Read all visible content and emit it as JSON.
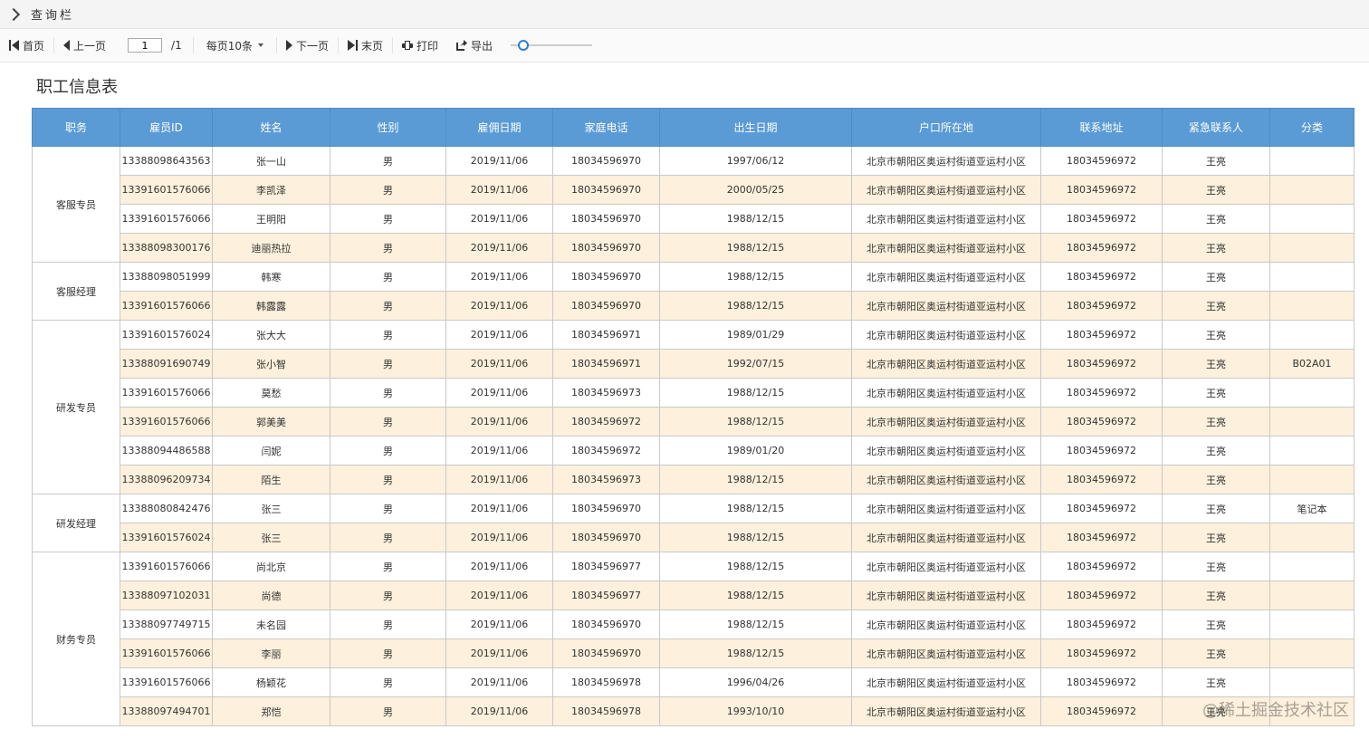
{
  "query_bar": {
    "label": "查询栏"
  },
  "toolbar": {
    "first": "首页",
    "prev": "上一页",
    "page_value": "1",
    "page_total": "/1",
    "page_size": "每页10条",
    "next": "下一页",
    "last": "末页",
    "print": "打印",
    "export": "导出",
    "zoom_fraction": 0.1
  },
  "report": {
    "title": "职工信息表",
    "columns": [
      "职务",
      "雇员ID",
      "姓名",
      "性别",
      "雇佣日期",
      "家庭电话",
      "出生日期",
      "户口所在地",
      "联系地址",
      "紧急联系人",
      "分类"
    ],
    "groups": [
      {
        "position": "客服专员",
        "rows": [
          [
            "13388098643563",
            "张一山",
            "男",
            "2019/11/06",
            "18034596970",
            "1997/06/12",
            "北京市朝阳区奥运村街道亚运村小区",
            "18034596972",
            "王亮",
            ""
          ],
          [
            "13391601576066",
            "李凯泽",
            "男",
            "2019/11/06",
            "18034596970",
            "2000/05/25",
            "北京市朝阳区奥运村街道亚运村小区",
            "18034596972",
            "王亮",
            ""
          ],
          [
            "13391601576066",
            "王明阳",
            "男",
            "2019/11/06",
            "18034596970",
            "1988/12/15",
            "北京市朝阳区奥运村街道亚运村小区",
            "18034596972",
            "王亮",
            ""
          ],
          [
            "13388098300176",
            "迪丽热拉",
            "男",
            "2019/11/06",
            "18034596970",
            "1988/12/15",
            "北京市朝阳区奥运村街道亚运村小区",
            "18034596972",
            "王亮",
            ""
          ]
        ]
      },
      {
        "position": "客服经理",
        "rows": [
          [
            "13388098051999",
            "韩寒",
            "男",
            "2019/11/06",
            "18034596970",
            "1988/12/15",
            "北京市朝阳区奥运村街道亚运村小区",
            "18034596972",
            "王亮",
            ""
          ],
          [
            "13391601576066",
            "韩露露",
            "男",
            "2019/11/06",
            "18034596970",
            "1988/12/15",
            "北京市朝阳区奥运村街道亚运村小区",
            "18034596972",
            "王亮",
            ""
          ]
        ]
      },
      {
        "position": "研发专员",
        "rows": [
          [
            "13391601576024",
            "张大大",
            "男",
            "2019/11/06",
            "18034596971",
            "1989/01/29",
            "北京市朝阳区奥运村街道亚运村小区",
            "18034596972",
            "王亮",
            ""
          ],
          [
            "13388091690749",
            "张小智",
            "男",
            "2019/11/06",
            "18034596971",
            "1992/07/15",
            "北京市朝阳区奥运村街道亚运村小区",
            "18034596972",
            "王亮",
            "B02A01"
          ],
          [
            "13391601576066",
            "莫愁",
            "男",
            "2019/11/06",
            "18034596973",
            "1988/12/15",
            "北京市朝阳区奥运村街道亚运村小区",
            "18034596972",
            "王亮",
            ""
          ],
          [
            "13391601576066",
            "郭美美",
            "男",
            "2019/11/06",
            "18034596972",
            "1988/12/15",
            "北京市朝阳区奥运村街道亚运村小区",
            "18034596972",
            "王亮",
            ""
          ],
          [
            "13388094486588",
            "闫妮",
            "男",
            "2019/11/06",
            "18034596972",
            "1989/01/20",
            "北京市朝阳区奥运村街道亚运村小区",
            "18034596972",
            "王亮",
            ""
          ],
          [
            "13388096209734",
            "陌生",
            "男",
            "2019/11/06",
            "18034596973",
            "1988/12/15",
            "北京市朝阳区奥运村街道亚运村小区",
            "18034596972",
            "王亮",
            ""
          ]
        ]
      },
      {
        "position": "研发经理",
        "rows": [
          [
            "13388080842476",
            "张三",
            "男",
            "2019/11/06",
            "18034596970",
            "1988/12/15",
            "北京市朝阳区奥运村街道亚运村小区",
            "18034596972",
            "王亮",
            "笔记本"
          ],
          [
            "13391601576024",
            "张三",
            "男",
            "2019/11/06",
            "18034596970",
            "1988/12/15",
            "北京市朝阳区奥运村街道亚运村小区",
            "18034596972",
            "王亮",
            ""
          ]
        ]
      },
      {
        "position": "财务专员",
        "rows": [
          [
            "13391601576066",
            "尚北京",
            "男",
            "2019/11/06",
            "18034596977",
            "1988/12/15",
            "北京市朝阳区奥运村街道亚运村小区",
            "18034596972",
            "王亮",
            ""
          ],
          [
            "13388097102031",
            "尚德",
            "男",
            "2019/11/06",
            "18034596977",
            "1988/12/15",
            "北京市朝阳区奥运村街道亚运村小区",
            "18034596972",
            "王亮",
            ""
          ],
          [
            "13388097749715",
            "未名园",
            "男",
            "2019/11/06",
            "18034596970",
            "1988/12/15",
            "北京市朝阳区奥运村街道亚运村小区",
            "18034596972",
            "王亮",
            ""
          ],
          [
            "13391601576066",
            "李丽",
            "男",
            "2019/11/06",
            "18034596970",
            "1988/12/15",
            "北京市朝阳区奥运村街道亚运村小区",
            "18034596972",
            "王亮",
            ""
          ],
          [
            "13391601576066",
            "杨颖花",
            "男",
            "2019/11/06",
            "18034596978",
            "1996/04/26",
            "北京市朝阳区奥运村街道亚运村小区",
            "18034596972",
            "王亮",
            ""
          ],
          [
            "13388097494701",
            "郑恺",
            "男",
            "2019/11/06",
            "18034596978",
            "1993/10/10",
            "北京市朝阳区奥运村街道亚运村小区",
            "18034596972",
            "王亮",
            ""
          ]
        ]
      }
    ]
  },
  "watermark": "@稀土掘金技术社区"
}
